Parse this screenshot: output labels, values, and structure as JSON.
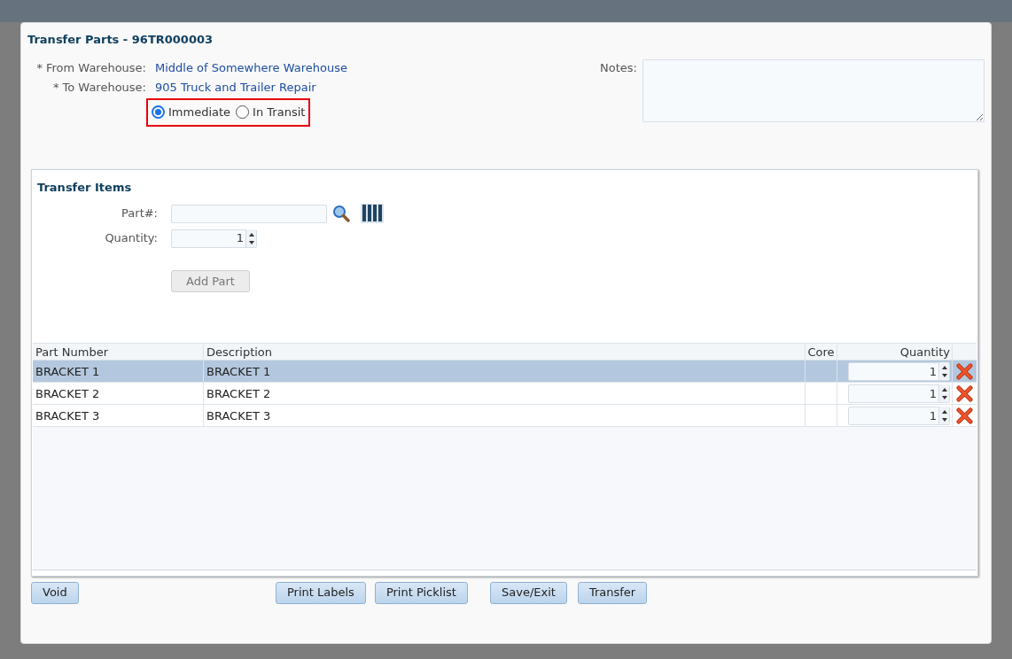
{
  "dialog": {
    "title": "Transfer Parts - 96TR000003"
  },
  "from_warehouse": {
    "label": "* From Warehouse:",
    "value": "Middle of Somewhere Warehouse"
  },
  "to_warehouse": {
    "label": "* To Warehouse:",
    "value": "905 Truck and Trailer Repair"
  },
  "transfer_mode": [
    {
      "label": "Immediate",
      "selected": true
    },
    {
      "label": "In Transit",
      "selected": false
    }
  ],
  "notes": {
    "label": "Notes:"
  },
  "transfer_items": {
    "title": "Transfer Items",
    "part_label": "Part#:",
    "quantity_label": "Quantity:",
    "quantity_value": "1",
    "add_button": {
      "label": "Add Part",
      "disabled": true
    }
  },
  "table": {
    "columns": [
      "Part Number",
      "Description",
      "Core",
      "Quantity"
    ],
    "rows": [
      {
        "part_number": "BRACKET 1",
        "description": "BRACKET 1",
        "quantity": "1",
        "selected": true
      },
      {
        "part_number": "BRACKET 2",
        "description": "BRACKET 2",
        "quantity": "1",
        "selected": false
      },
      {
        "part_number": "BRACKET 3",
        "description": "BRACKET 3",
        "quantity": "1",
        "selected": false
      }
    ]
  },
  "left_buttons": [
    "Void"
  ],
  "middle_buttons": [
    "Print Labels",
    "Print Picklist"
  ],
  "right_buttons": [
    "Save/Exit",
    "Transfer"
  ]
}
